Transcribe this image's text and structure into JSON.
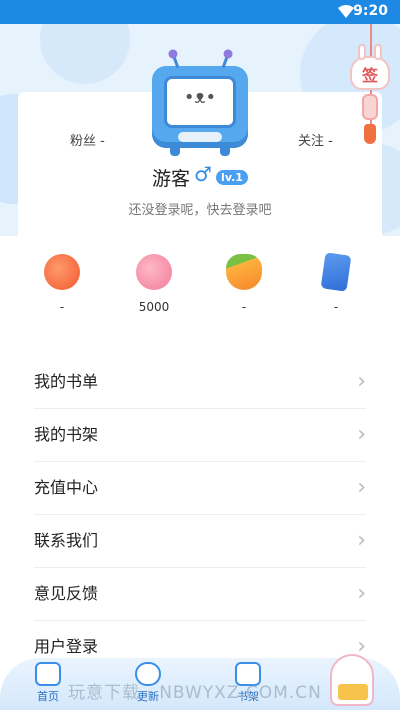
{
  "status_bar": {
    "time": "9:20"
  },
  "profile": {
    "fans_label": "粉丝 -",
    "follow_label": "关注 -",
    "username": "游客",
    "gender_symbol": "♂",
    "level": "lv.1",
    "login_hint": "还没登录呢，快去登录吧"
  },
  "sign_in": {
    "label": "签"
  },
  "assets": [
    {
      "icon": "tomato-icon",
      "value": "-"
    },
    {
      "icon": "bunny-coin-icon",
      "value": "5000"
    },
    {
      "icon": "carrot-icon",
      "value": "-"
    },
    {
      "icon": "ticket-card-icon",
      "value": "-"
    }
  ],
  "menu": [
    {
      "label": "我的书单"
    },
    {
      "label": "我的书架"
    },
    {
      "label": "充值中心"
    },
    {
      "label": "联系我们"
    },
    {
      "label": "意见反馈"
    },
    {
      "label": "用户登录"
    }
  ],
  "bottom_nav": [
    {
      "label": "首页",
      "icon": "home-icon"
    },
    {
      "label": "更新",
      "icon": "update-icon"
    },
    {
      "label": "书架",
      "icon": "bookshelf-icon"
    },
    {
      "label": "",
      "icon": "mascot-icon"
    }
  ],
  "watermark": "玩意下载 · NBWYXZ.COM.CN",
  "colors": {
    "accent": "#1e88e5",
    "level_badge": "#4a9ff0",
    "sign": "#e05757"
  }
}
